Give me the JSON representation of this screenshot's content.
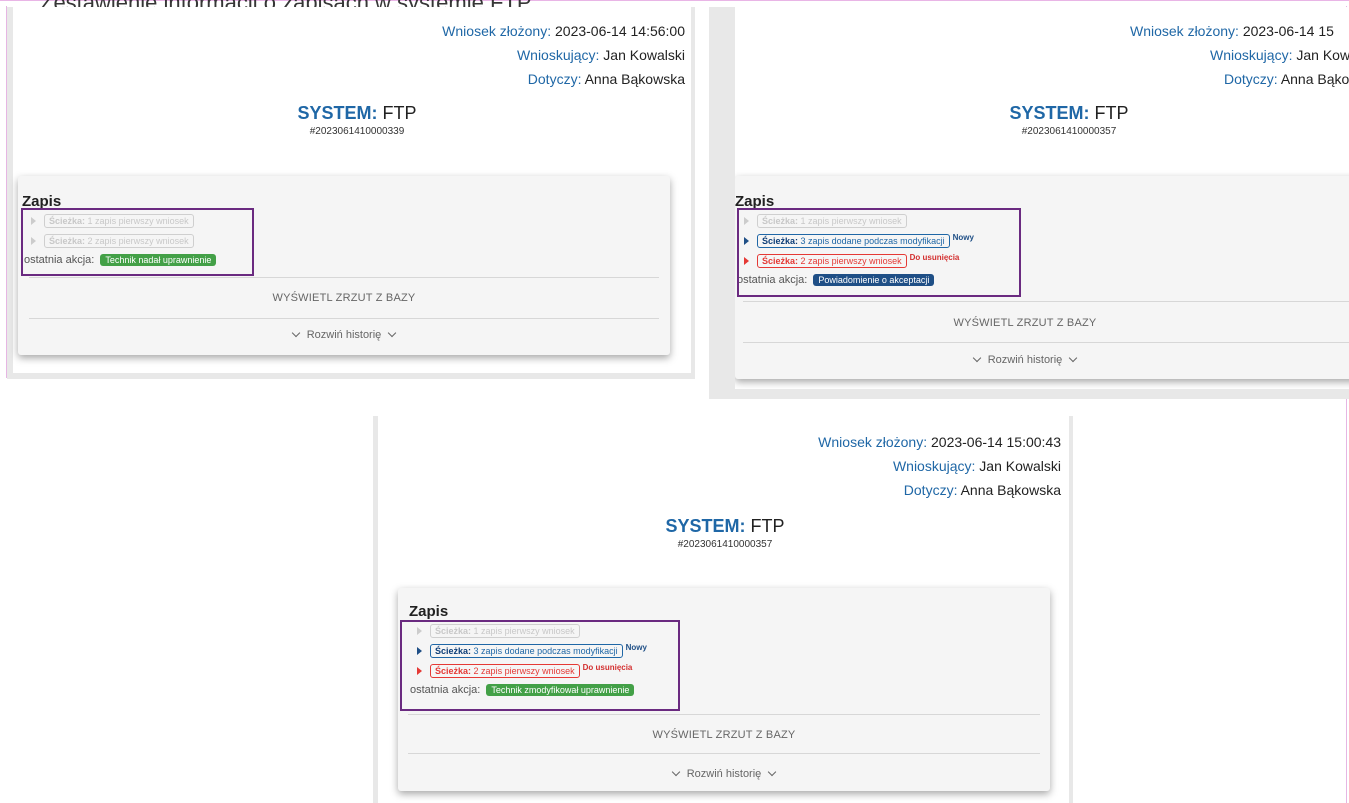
{
  "header_cut": "Zestawienie informacji o zapisach w systemie FTP",
  "labels": {
    "submitted": "Wniosek złożony:",
    "applicant": "Wnioskujący:",
    "concerns": "Dotyczy:",
    "system": "SYSTEM:",
    "section": "Zapis",
    "path": "Ścieżka:",
    "last_action": "ostatnia akcja:",
    "show_snapshot": "WYŚWIETL ZRZUT Z BAZY",
    "expand_history": "Rozwiń historię",
    "badge_new": "Nowy",
    "badge_delete": "Do usunięcia"
  },
  "panels": [
    {
      "submitted": "2023-06-14 14:56:00",
      "applicant": "Jan Kowalski",
      "concerns": "Anna Bąkowska",
      "system": "FTP",
      "request_id": "#2023061410000339",
      "rows": [
        {
          "num": "1 zapis pierwszy wniosek"
        },
        {
          "num": "2 zapis pierwszy wniosek"
        }
      ],
      "last_action": "Technik nadał uprawnienie"
    },
    {
      "submitted": "2023-06-14 15",
      "applicant": "Jan Kowalski",
      "concerns": "Anna Bąkowska",
      "system": "FTP",
      "request_id": "#2023061410000357",
      "rows": [
        {
          "num": "1 zapis pierwszy wniosek"
        },
        {
          "num": "3 zapis dodane podczas modyfikacji"
        },
        {
          "num": "2 zapis pierwszy wniosek"
        }
      ],
      "last_action": "Powiadomienie o akceptacji"
    },
    {
      "submitted": "2023-06-14 15:00:43",
      "applicant": "Jan Kowalski",
      "concerns": "Anna Bąkowska",
      "system": "FTP",
      "request_id": "#2023061410000357",
      "rows": [
        {
          "num": "1 zapis pierwszy wniosek"
        },
        {
          "num": "3 zapis dodane podczas modyfikacji"
        },
        {
          "num": "2 zapis pierwszy wniosek"
        }
      ],
      "last_action": "Technik zmodyfikował uprawnienie"
    }
  ],
  "colors": {
    "accent": "#1f67a6",
    "highlight": "#6a2a80",
    "green": "#43a047",
    "red": "#e53935"
  }
}
